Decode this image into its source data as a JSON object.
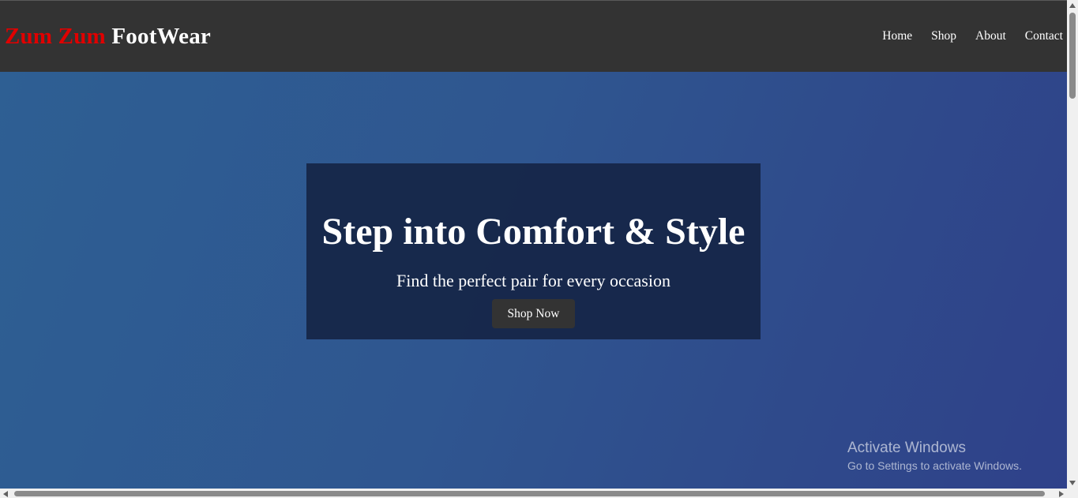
{
  "brand": {
    "part1": "Zum Zum",
    "part2": "FootWear",
    "part1_color": "#e00000",
    "part2_color": "#ffffff"
  },
  "nav": {
    "items": [
      {
        "label": "Home"
      },
      {
        "label": "Shop"
      },
      {
        "label": "About"
      },
      {
        "label": "Contact"
      }
    ]
  },
  "hero": {
    "title": "Step into Comfort & Style",
    "subtitle": "Find the perfect pair for every occasion",
    "cta_label": "Shop Now"
  },
  "watermark": {
    "title": "Activate Windows",
    "subtitle": "Go to Settings to activate Windows."
  },
  "colors": {
    "navbar": "#333333",
    "hero_start": "#2e5f93",
    "hero_end": "#2f418a",
    "hero_box": "#162546"
  }
}
